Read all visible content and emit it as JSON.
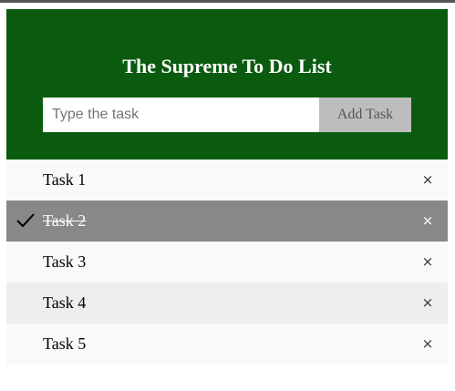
{
  "header": {
    "title": "The Supreme To Do List",
    "input_placeholder": "Type the task",
    "input_value": "",
    "add_button_label": "Add Task"
  },
  "tasks": [
    {
      "label": "Task 1",
      "checked": false,
      "close_label": "×"
    },
    {
      "label": "Task 2",
      "checked": true,
      "close_label": "×"
    },
    {
      "label": "Task 3",
      "checked": false,
      "close_label": "×"
    },
    {
      "label": "Task 4",
      "checked": false,
      "close_label": "×"
    },
    {
      "label": "Task 5",
      "checked": false,
      "close_label": "×"
    }
  ],
  "colors": {
    "header_bg": "#0a5b0f",
    "checked_bg": "#888888",
    "row_light": "#f9f9f9",
    "row_dark": "#eeeeee",
    "button_bg": "#bdbdbd"
  }
}
